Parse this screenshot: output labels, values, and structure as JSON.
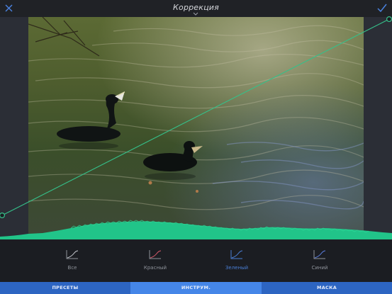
{
  "header": {
    "title": "Коррекция",
    "close_icon": "close-icon",
    "confirm_icon": "check-icon"
  },
  "curve": {
    "selected_channel": "Зеленый",
    "color": "#35c08a",
    "histogram_color": "#21c489"
  },
  "channels": [
    {
      "id": "all",
      "label": "Все",
      "color": "#c7cad0",
      "active": false
    },
    {
      "id": "red",
      "label": "Красный",
      "color": "#d85a6a",
      "active": false
    },
    {
      "id": "green",
      "label": "Зеленый",
      "color": "#4a7fd6",
      "active": true
    },
    {
      "id": "blue",
      "label": "Синий",
      "color": "#5b7ee0",
      "active": false
    }
  ],
  "tabs": [
    {
      "label": "ПРЕСЕТЫ",
      "active": false
    },
    {
      "label": "ИНСТРУМ.",
      "active": true
    },
    {
      "label": "МАСКА",
      "active": false
    }
  ],
  "colors": {
    "accent": "#2d65c2",
    "accent_active": "#4586e8",
    "background": "#1b1d22"
  }
}
